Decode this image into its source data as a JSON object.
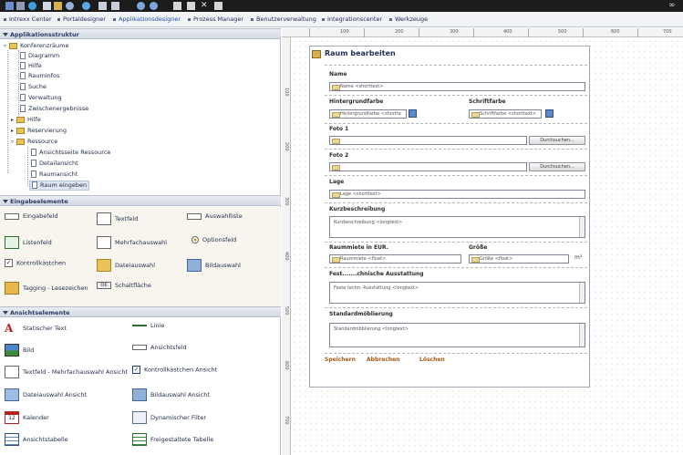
{
  "menu": {
    "items": [
      {
        "label": "Intrexx Center"
      },
      {
        "label": "Portaldesigner"
      },
      {
        "label": "Applikationsdesigner"
      },
      {
        "label": "Prozess Manager"
      },
      {
        "label": "Benutzerverwaltung"
      },
      {
        "label": "Integrationscenter"
      },
      {
        "label": "Werkzeuge"
      }
    ]
  },
  "tree": {
    "header": "Applikationsstruktur",
    "root": "Konferenzräume",
    "items": [
      "Diagramm",
      "Hilfe",
      "Rauminfos",
      "Suche",
      "Verwaltung",
      "Zwischenergebnisse"
    ],
    "groups": [
      "Hilfe",
      "Reservierung",
      "Ressource"
    ],
    "sub": [
      "Ansichtsseite Ressource",
      "Detailansicht",
      "Raumansicht",
      "Raum eingeben"
    ]
  },
  "input_elements": {
    "header": "Eingabeelemente",
    "items": [
      "Eingabefeld",
      "Textfeld",
      "Auswahlliste",
      "Listenfeld",
      "Mehrfachauswahl",
      "Optionsfeld",
      "Kontrollkästchen",
      "Dateiauswahl",
      "Bildauswahl",
      "Tagging - Lesezeichen",
      "Schaltfläche"
    ]
  },
  "view_elements": {
    "header": "Ansichtselemente",
    "items": [
      "Statischer Text",
      "Linie",
      "Bild",
      "Ansichtsfeld",
      "Textfeld - Mehrfachauswahl Ansicht",
      "Kontrollkästchen Ansicht",
      "Dateiauswahl Ansicht",
      "Bildauswahl Ansicht",
      "Kalender",
      "Dynamischer Filter",
      "Ansichtstabelle",
      "Freigestaltete Tabelle"
    ]
  },
  "ruler": {
    "h": [
      "100",
      "200",
      "300",
      "400",
      "500",
      "600",
      "700"
    ],
    "v": [
      "100",
      "200",
      "300",
      "400",
      "500",
      "600",
      "700"
    ]
  },
  "form": {
    "title": "Raum bearbeiten",
    "name_label": "Name",
    "name_value": "Name <shorttext>",
    "bg_label": "Hintergrundfarbe",
    "bg_value": "Hintergrundfarbe <shortte",
    "font_label": "Schriftfarbe",
    "font_value": "Schriftfarbe <shorttext>",
    "foto1_label": "Foto 1",
    "foto2_label": "Foto 2",
    "browse": "Durchsuchen...",
    "lage_label": "Lage",
    "lage_value": "Lage <shorttext>",
    "kurz_label": "Kurzbeschreibung",
    "kurz_value": "Kurzbeschreibung <longtext>",
    "miete_label": "Raummiete in EUR.",
    "miete_value": "Raummiete <float>",
    "groesse_label": "Größe",
    "groesse_value": "Größe <float>",
    "unit": "m²",
    "ausst_label": "Fest.......chnische Ausstattung",
    "ausst_value": "Feste techn. Ausstattung <longtext>",
    "moeb_label": "Standardmöblierung",
    "moeb_value": "Standardmöblierung <longtext>",
    "save": "Speichern",
    "cancel": "Abbrechen",
    "delete": "Löschen"
  }
}
